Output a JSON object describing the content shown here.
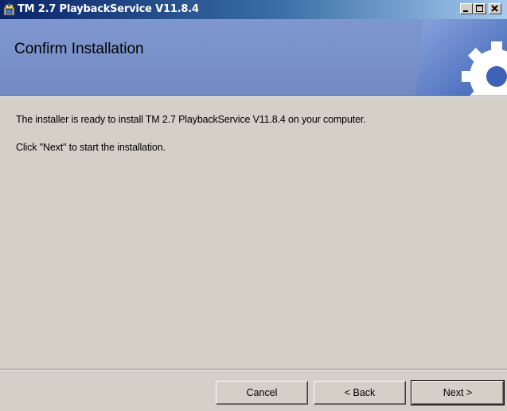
{
  "window": {
    "title": "TM 2.7 PlaybackService V11.8.4",
    "icon": "installer-package-icon",
    "controls": {
      "minimize": "minimize-icon",
      "maximize": "maximize-icon",
      "close": "close-icon"
    }
  },
  "header": {
    "title": "Confirm Installation",
    "art": "gear-icon"
  },
  "body": {
    "line1": "The installer is ready to install TM 2.7 PlaybackService V11.8.4 on your computer.",
    "line2": "Click \"Next\" to start the installation."
  },
  "buttons": {
    "cancel": "Cancel",
    "back": "< Back",
    "next": "Next >"
  },
  "colors": {
    "banner": "#7a91c9",
    "dialog": "#d4d0c8",
    "titlebar_start": "#0a246a",
    "titlebar_end": "#a6caf0"
  }
}
